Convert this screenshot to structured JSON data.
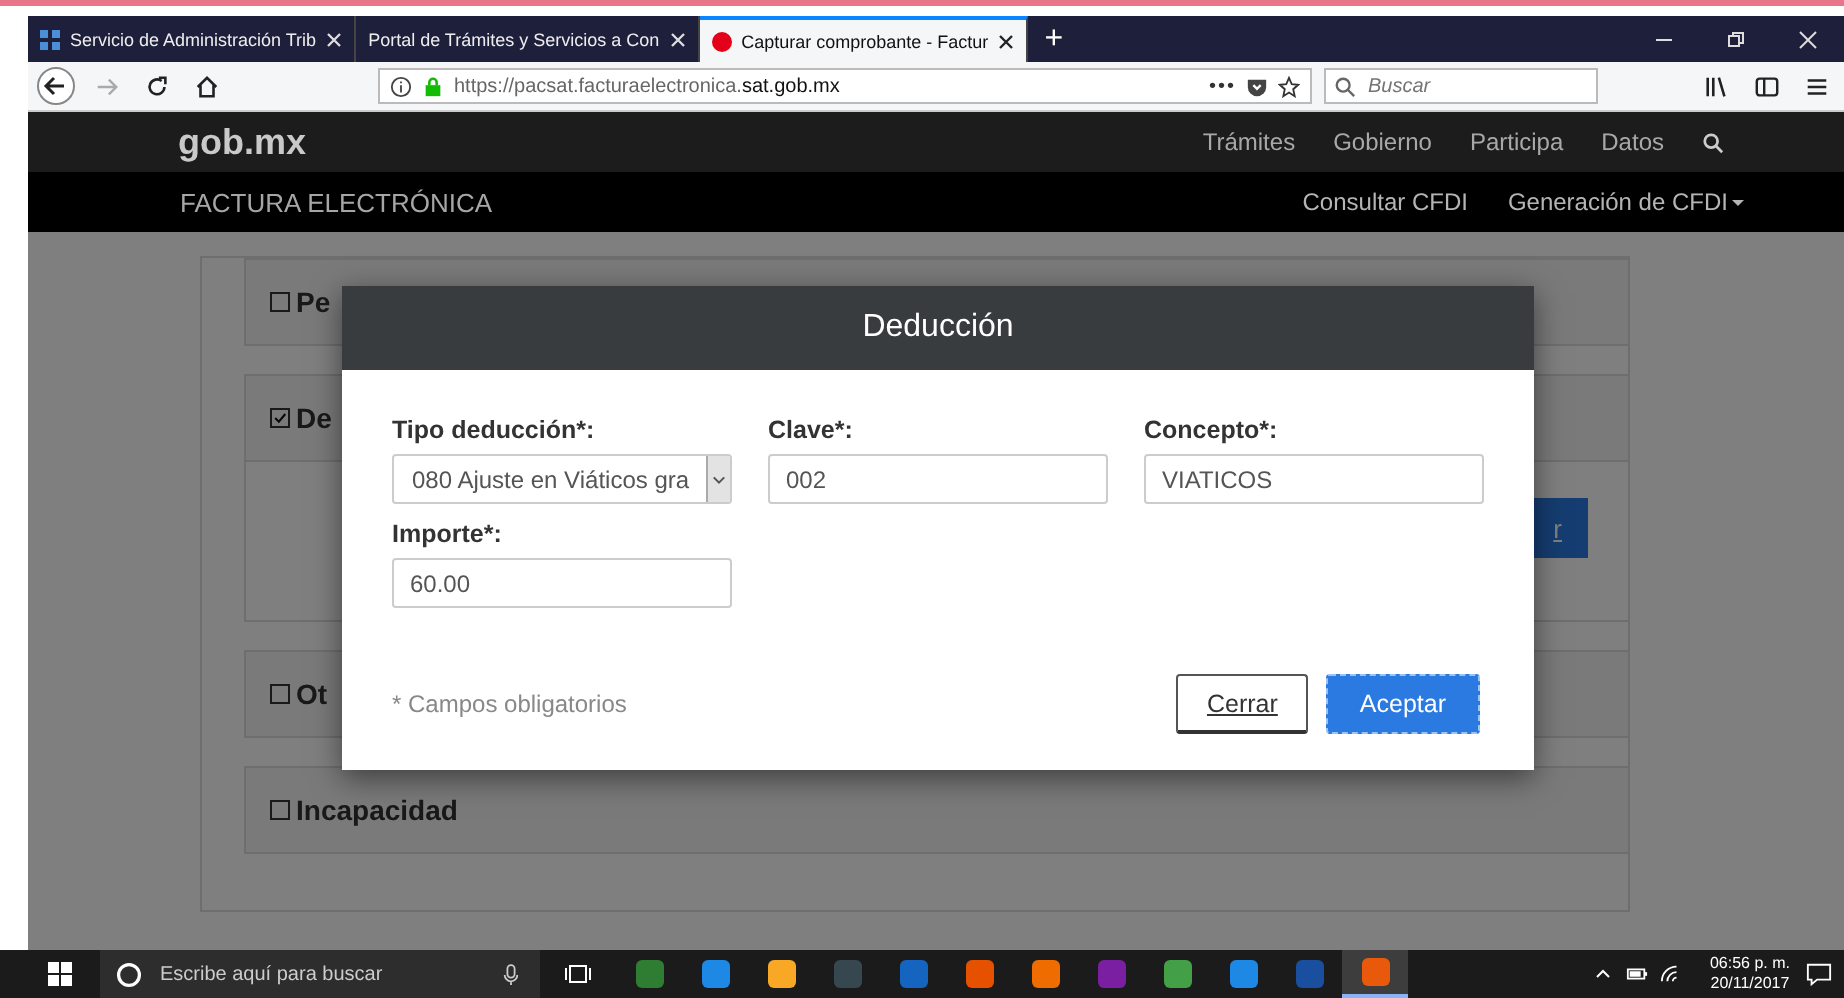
{
  "browser": {
    "tabs": [
      {
        "title": "Servicio de Administración Trib",
        "selected": false,
        "kind": "sat"
      },
      {
        "title": "Portal de Trámites y Servicios a Con",
        "selected": false,
        "kind": "plain"
      },
      {
        "title": "Capturar comprobante - Factur",
        "selected": true,
        "kind": "dot"
      }
    ],
    "new_tab": "+",
    "url_host": "https://pacsat.facturaelectronica.",
    "url_domain": "sat.gob.mx",
    "page_actions": "•••",
    "search_placeholder": "Buscar"
  },
  "site": {
    "logo": "gob.mx",
    "nav": [
      "Trámites",
      "Gobierno",
      "Participa",
      "Datos"
    ],
    "subtitle": "FACTURA ELECTRÓNICA",
    "subnav": [
      {
        "label": "Consultar CFDI",
        "dropdown": false
      },
      {
        "label": "Generación de CFDI",
        "dropdown": true
      }
    ]
  },
  "sections": [
    {
      "label": "Pe",
      "checked": false
    },
    {
      "label": "De",
      "checked": true,
      "button": "r"
    },
    {
      "label": "Ot",
      "checked": false
    },
    {
      "label": "Incapacidad",
      "checked": false
    }
  ],
  "modal": {
    "title": "Deducción",
    "fields": [
      {
        "label": "Tipo deducción*:",
        "kind": "select",
        "value": "080 Ajuste en Viáticos gra"
      },
      {
        "label": "Clave*:",
        "kind": "input",
        "value": "002"
      },
      {
        "label": "Concepto*:",
        "kind": "input",
        "value": "VIATICOS"
      },
      {
        "label": "Importe*:",
        "kind": "input",
        "value": "60.00"
      }
    ],
    "note": "* Campos obligatorios",
    "buttons": [
      {
        "label": "Cerrar",
        "kind": "secondary"
      },
      {
        "label": "Aceptar",
        "kind": "primary"
      }
    ]
  },
  "taskbar": {
    "search_placeholder": "Escribe aquí para buscar",
    "time": "06:56 p. m.",
    "date": "20/11/2017"
  }
}
